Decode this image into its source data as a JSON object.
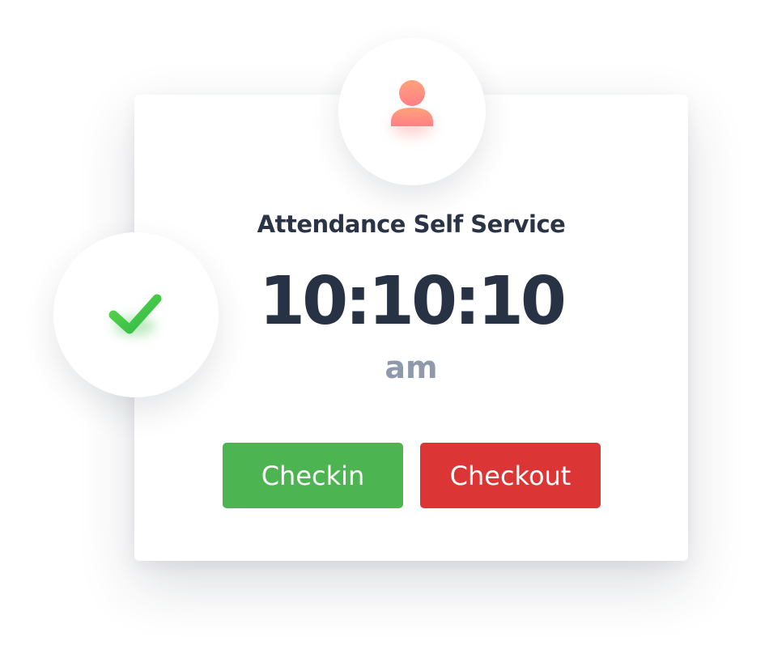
{
  "card": {
    "title": "Attendance Self Service",
    "time": "10:10:10",
    "period": "am"
  },
  "icons": {
    "avatar": "user-icon",
    "check": "checkmark-icon"
  },
  "buttons": {
    "checkin_label": "Checkin",
    "checkout_label": "Checkout"
  },
  "colors": {
    "checkin": "#4cb551",
    "checkout": "#dc3535",
    "title_text": "#2b3446",
    "period_text": "#8e9aac",
    "avatar_gradient": [
      "#ffa27a",
      "#ff7f86"
    ],
    "check_gradient": [
      "#5bd646",
      "#2fb84a"
    ]
  }
}
